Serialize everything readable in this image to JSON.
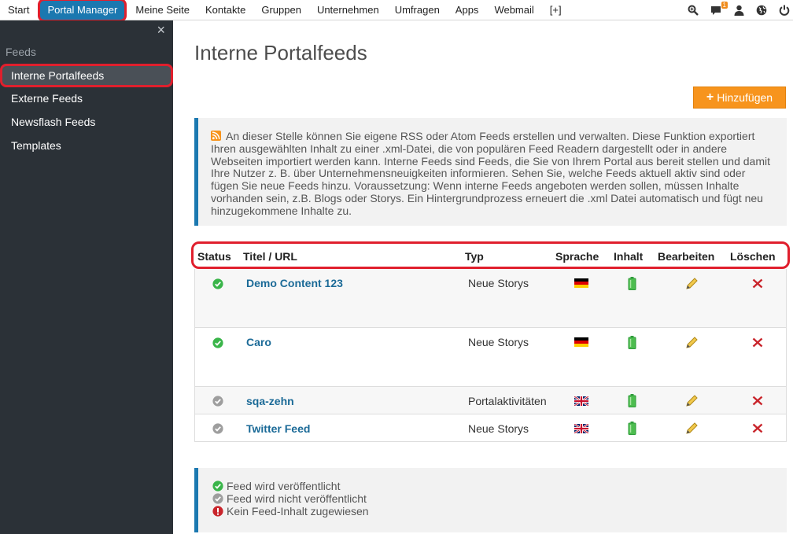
{
  "topnav": {
    "items": [
      "Start",
      "Portal Manager",
      "Meine Seite",
      "Kontakte",
      "Gruppen",
      "Unternehmen",
      "Umfragen",
      "Apps",
      "Webmail",
      "[+]"
    ],
    "notification_count": "1"
  },
  "sidebar": {
    "close": "×",
    "section": "Feeds",
    "items": [
      "Interne Portalfeeds",
      "Externe Feeds",
      "Newsflash Feeds",
      "Templates"
    ]
  },
  "main": {
    "title": "Interne Portalfeeds",
    "add_button": "Hinzufügen",
    "info": "An dieser Stelle können Sie eigene RSS oder Atom Feeds erstellen und verwalten. Diese Funktion exportiert Ihren ausgewählten Inhalt zu einer .xml-Datei, die von populären Feed Readern dargestellt oder in andere Webseiten importiert werden kann. Interne Feeds sind Feeds, die Sie von Ihrem Portal aus bereit stellen und damit Ihre Nutzer z. B. über Unternehmensneuigkeiten informieren. Sehen Sie, welche Feeds aktuell aktiv sind oder fügen Sie neue Feeds hinzu. Voraussetzung: Wenn interne Feeds angeboten werden sollen, müssen Inhalte vorhanden sein, z.B. Blogs oder Storys. Ein Hintergrundprozess erneuert die .xml Datei automatisch und fügt neu hinzugekommene Inhalte zu.",
    "table": {
      "headers": {
        "status": "Status",
        "title": "Titel / URL",
        "type": "Typ",
        "language": "Sprache",
        "content": "Inhalt",
        "edit": "Bearbeiten",
        "delete": "Löschen"
      },
      "rows": [
        {
          "status": "published",
          "title": "Demo Content 123",
          "type": "Neue Storys",
          "language": "de-flag-icon"
        },
        {
          "status": "published",
          "title": "Caro",
          "type": "Neue Storys",
          "language": "de-flag-icon"
        },
        {
          "status": "unpublished",
          "title": "sqa-zehn",
          "type": "Portalaktivitäten",
          "language": "uk-flag-icon"
        },
        {
          "status": "unpublished",
          "title": "Twitter Feed",
          "type": "Neue Storys",
          "language": "uk-flag-icon"
        }
      ]
    },
    "legend": [
      "Feed wird veröffentlicht",
      "Feed wird nicht veröffentlicht",
      "Kein Feed-Inhalt zugewiesen"
    ]
  },
  "colors": {
    "accent": "#1b78b0",
    "highlight": "#e01f2d",
    "add_button": "#f7941d",
    "published": "#3ab54a",
    "unpublished": "#9e9e9e",
    "error": "#c9252c"
  }
}
